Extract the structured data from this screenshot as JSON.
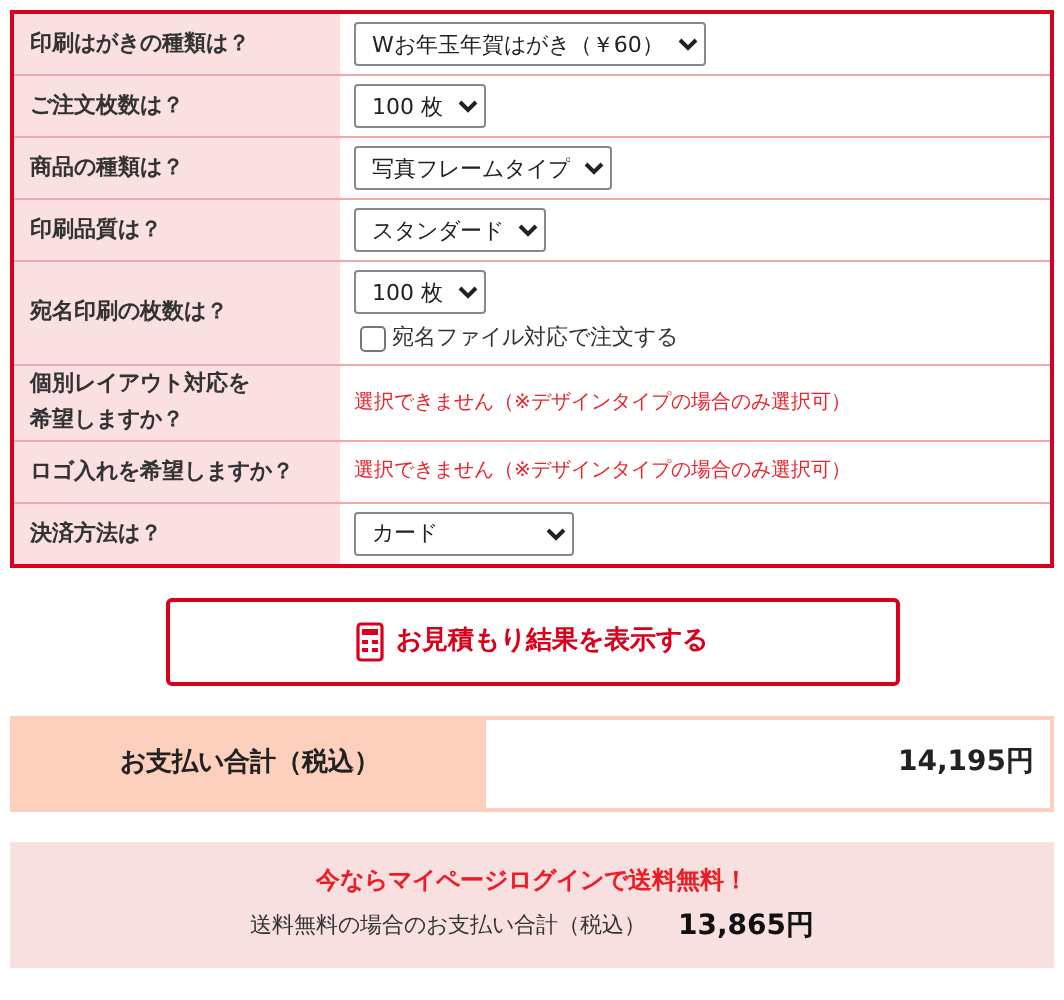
{
  "form_rows": [
    {
      "label": "印刷はがきの種類は？",
      "kind": "select",
      "value": "Wお年玉年賀はがき（￥60）"
    },
    {
      "label": "ご注文枚数は？",
      "kind": "select",
      "value": "100 枚"
    },
    {
      "label": "商品の種類は？",
      "kind": "select",
      "value": "写真フレームタイプ"
    },
    {
      "label": "印刷品質は？",
      "kind": "select",
      "value": "スタンダード"
    },
    {
      "label": "宛名印刷の枚数は？",
      "kind": "select_checkbox",
      "value": "100 枚",
      "checkbox": {
        "label": "宛名ファイル対応で注文する",
        "checked": false
      }
    },
    {
      "label_lines": [
        "個別レイアウト対応を",
        "希望しますか？"
      ],
      "kind": "note",
      "value": "選択できません（※デザインタイプの場合のみ選択可）"
    },
    {
      "label": "ロゴ入れを希望しますか？",
      "kind": "note",
      "value": "選択できません（※デザインタイプの場合のみ選択可）"
    },
    {
      "label": "決済方法は？",
      "kind": "select_wide",
      "value": "カード"
    }
  ],
  "estimate_button": "お見積もり結果を表示する",
  "total": {
    "label": "お支払い合計（税込）",
    "amount": "14,195円"
  },
  "promo": {
    "headline": "今ならマイページログインで送料無料！",
    "label": "送料無料の場合のお支払い合計（税込）",
    "amount": "13,865円"
  }
}
